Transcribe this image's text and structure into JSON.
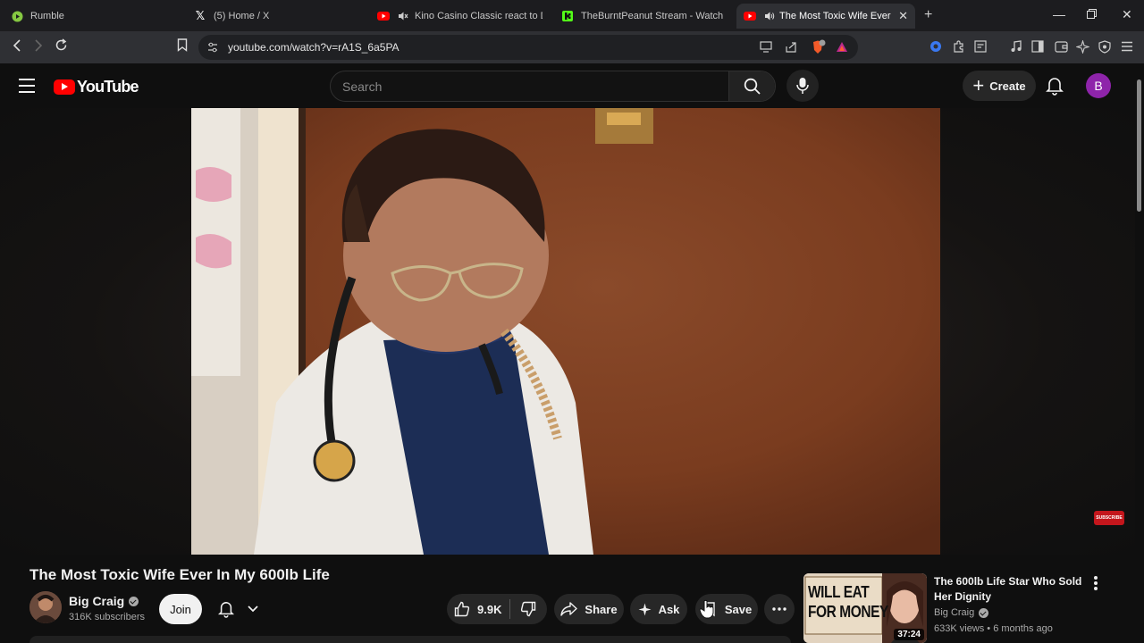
{
  "browser": {
    "tabs": [
      {
        "title": "Rumble",
        "icon": "rumble-icon"
      },
      {
        "title": "(5) Home / X",
        "icon": "x-icon"
      },
      {
        "title": "Kino Casino Classic react to DSPG",
        "icon": "youtube-icon"
      },
      {
        "title": "TheBurntPeanut Stream - Watch Live",
        "icon": "kick-icon"
      },
      {
        "title": "The Most Toxic Wife Ever In My",
        "icon": "youtube-icon"
      }
    ],
    "url": "youtube.com/watch?v=rA1S_6a5PA"
  },
  "header": {
    "logo_text": "YouTube",
    "search_placeholder": "Search",
    "create_label": "Create",
    "avatar_letter": "B"
  },
  "video": {
    "title": "The Most Toxic Wife Ever In My 600lb Life",
    "subscribe_badge": "SUBSCRIBE"
  },
  "channel": {
    "name": "Big Craig",
    "subscribers": "316K subscribers",
    "join_label": "Join"
  },
  "actions": {
    "likes": "9.9K",
    "share_label": "Share",
    "ask_label": "Ask",
    "save_label": "Save"
  },
  "recommendation": {
    "thumb_line1": "WILL EAT",
    "thumb_line2": "FOR MONEY",
    "duration": "37:24",
    "title": "The 600lb Life Star Who Sold Her Dignity",
    "channel": "Big Craig",
    "meta": "633K views • 6 months ago"
  },
  "colors": {
    "youtube_red": "#ff0000",
    "avatar_purple": "#8e24aa",
    "background": "#0f0f0f"
  }
}
